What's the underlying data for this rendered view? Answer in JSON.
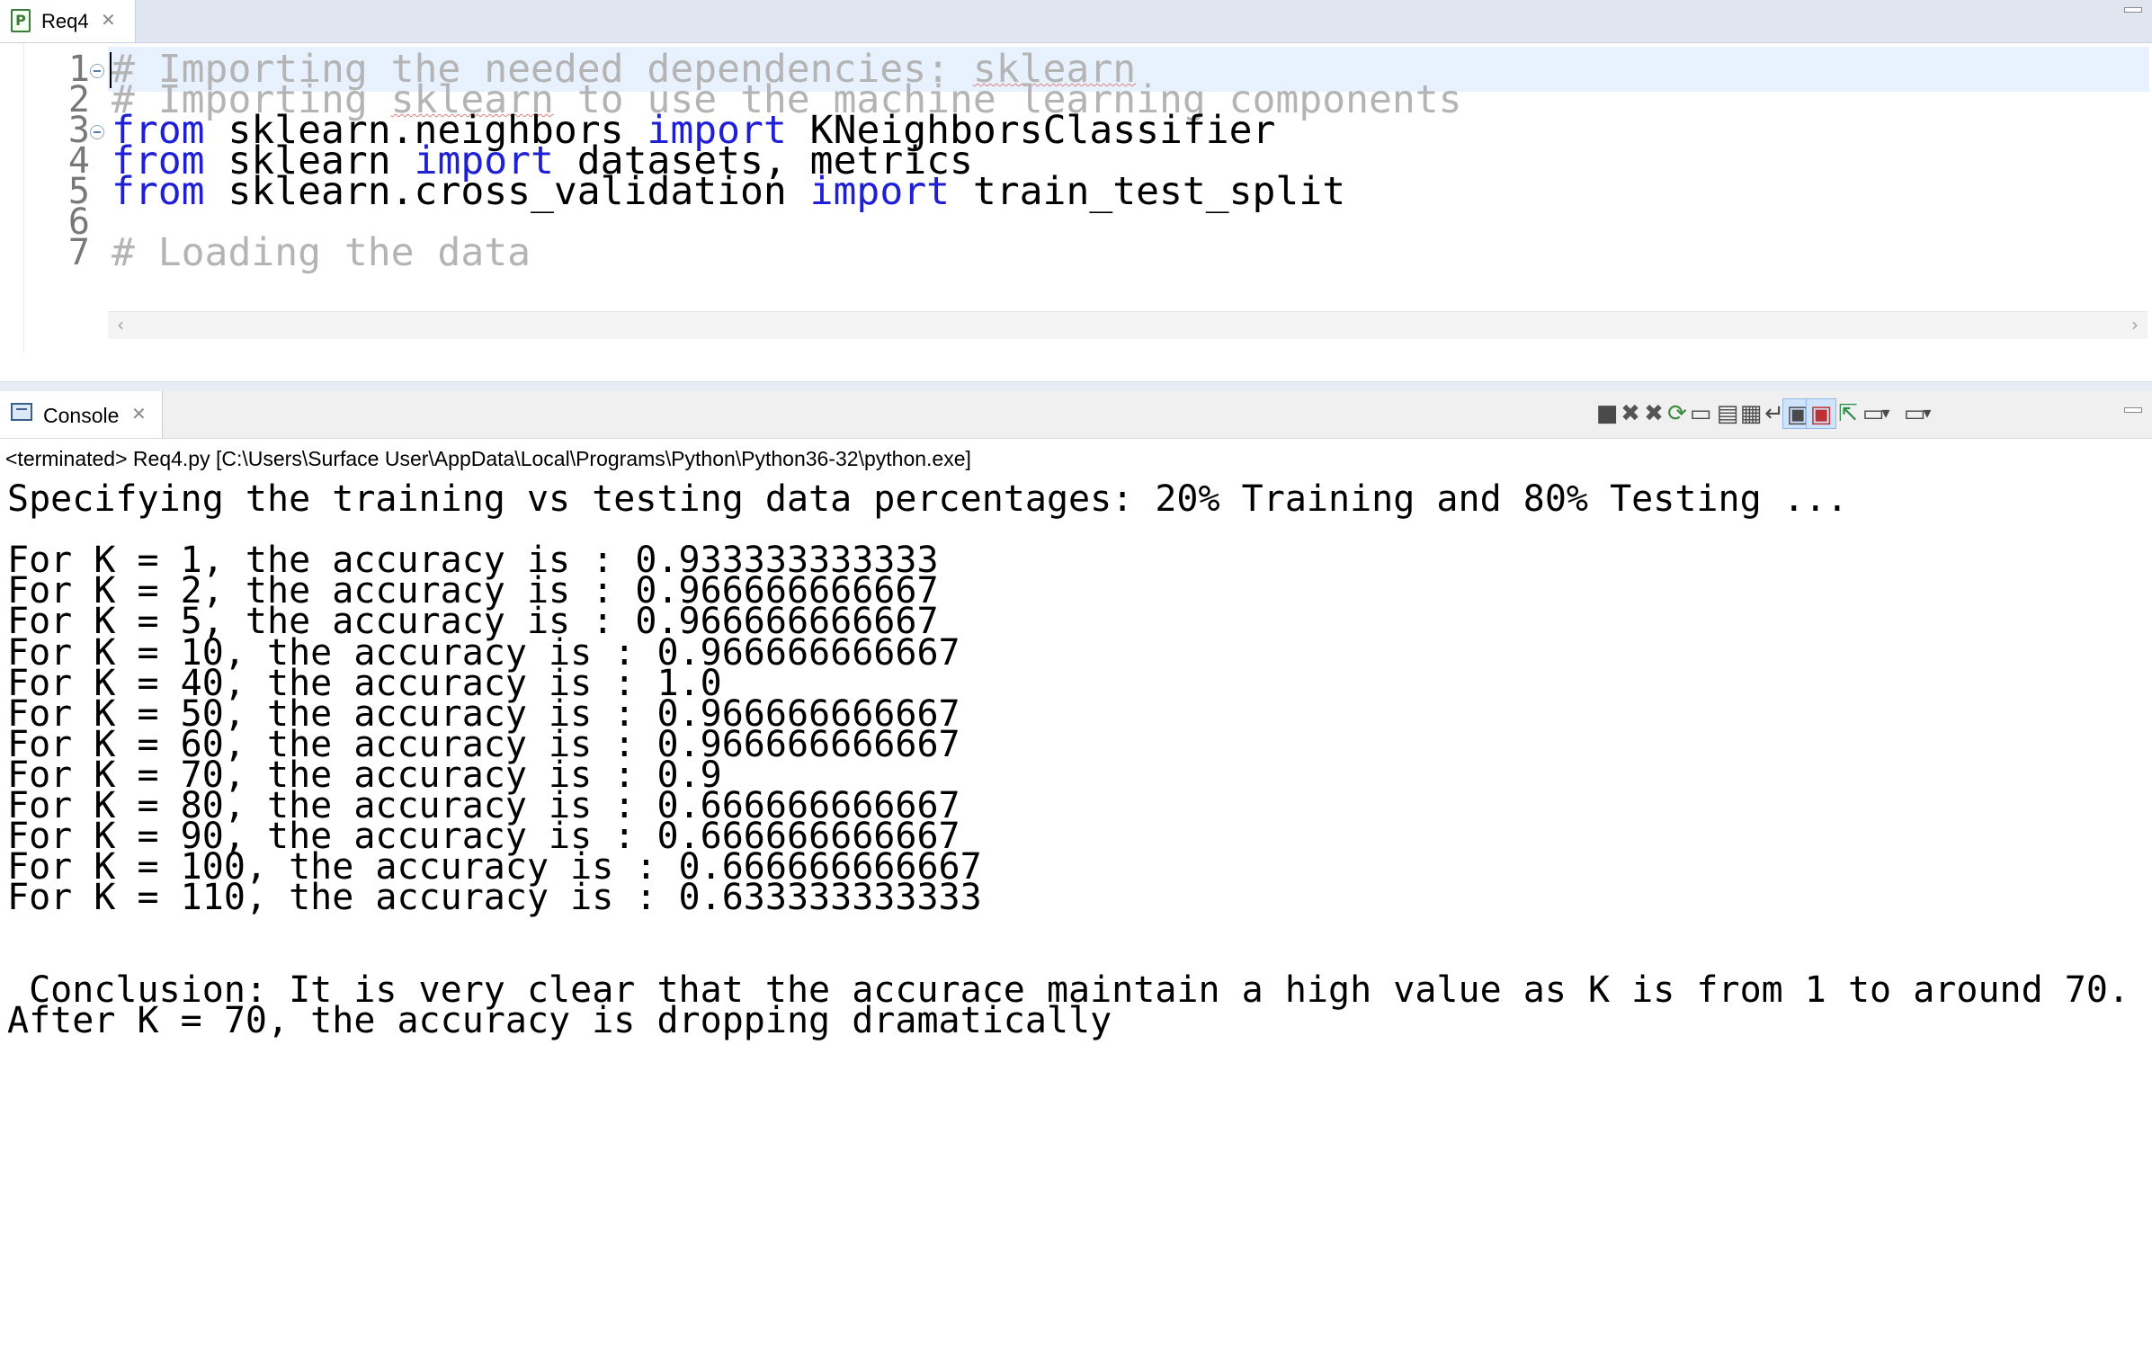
{
  "editor": {
    "tab_label": "Req4",
    "tab_close": "✕",
    "tab_icon_letter": "P",
    "lines": [
      {
        "num": "1",
        "segments": [
          {
            "t": "# Importing the needed dependencies: ",
            "c": "cm"
          },
          {
            "t": "sklearn",
            "c": "cm sq"
          }
        ]
      },
      {
        "num": "2",
        "segments": [
          {
            "t": "# Importing ",
            "c": "cm"
          },
          {
            "t": "sklearn",
            "c": "cm sq"
          },
          {
            "t": " to use the machine learning components",
            "c": "cm"
          }
        ]
      },
      {
        "num": "3",
        "segments": [
          {
            "t": "from",
            "c": "kw"
          },
          {
            "t": " sklearn.neighbors ",
            "c": ""
          },
          {
            "t": "import",
            "c": "kw"
          },
          {
            "t": " KNeighborsClassifier",
            "c": ""
          }
        ]
      },
      {
        "num": "4",
        "segments": [
          {
            "t": "from",
            "c": "kw"
          },
          {
            "t": " sklearn ",
            "c": ""
          },
          {
            "t": "import",
            "c": "kw"
          },
          {
            "t": " datasets, metrics",
            "c": ""
          }
        ]
      },
      {
        "num": "5",
        "segments": [
          {
            "t": "from",
            "c": "kw"
          },
          {
            "t": " sklearn.cross_validation ",
            "c": ""
          },
          {
            "t": "import",
            "c": "kw"
          },
          {
            "t": " train_test_split",
            "c": ""
          }
        ]
      },
      {
        "num": "6",
        "segments": []
      },
      {
        "num": "7",
        "segments": [
          {
            "t": "# Loading the data",
            "c": "cm"
          }
        ]
      }
    ]
  },
  "console": {
    "tab_label": "Console",
    "tab_close": "✕",
    "status": "<terminated> Req4.py [C:\\Users\\Surface User\\AppData\\Local\\Programs\\Python\\Python36-32\\python.exe]",
    "toolbar_icons": [
      {
        "name": "terminate-icon",
        "glyph": "■"
      },
      {
        "name": "remove-launch-icon",
        "glyph": "✖"
      },
      {
        "name": "remove-all-terminated-icon",
        "glyph": "✖"
      },
      {
        "name": "relaunch-icon",
        "glyph": "⟳"
      },
      {
        "name": "pin-console-icon",
        "glyph": "▭"
      },
      {
        "name": "clear-console-icon",
        "glyph": "▤"
      },
      {
        "name": "scroll-lock-icon",
        "glyph": "▦"
      },
      {
        "name": "word-wrap-icon",
        "glyph": "↵"
      },
      {
        "name": "show-on-stdout-icon",
        "glyph": "▣"
      },
      {
        "name": "show-on-stderr-icon",
        "glyph": "▣"
      },
      {
        "name": "pin-icon",
        "glyph": "⇱"
      },
      {
        "name": "display-selected-console-icon",
        "glyph": "▭"
      },
      {
        "name": "display-dropdown-icon",
        "glyph": "▾"
      },
      {
        "name": "open-console-icon",
        "glyph": "▭"
      },
      {
        "name": "open-console-dropdown-icon",
        "glyph": "▾"
      }
    ],
    "output": [
      "Specifying the training vs testing data percentages: 20% Training and 80% Testing ...",
      "",
      "For K = 1, the accuracy is : 0.933333333333",
      "For K = 2, the accuracy is : 0.966666666667",
      "For K = 5, the accuracy is : 0.966666666667",
      "For K = 10, the accuracy is : 0.966666666667",
      "For K = 40, the accuracy is : 1.0",
      "For K = 50, the accuracy is : 0.966666666667",
      "For K = 60, the accuracy is : 0.966666666667",
      "For K = 70, the accuracy is : 0.9",
      "For K = 80, the accuracy is : 0.666666666667",
      "For K = 90, the accuracy is : 0.666666666667",
      "For K = 100, the accuracy is : 0.666666666667",
      "For K = 110, the accuracy is : 0.633333333333",
      "",
      "",
      " Conclusion: It is very clear that the accurace maintain a high value as K is from 1 to around 70.",
      "After K = 70, the accuracy is dropping dramatically"
    ]
  }
}
